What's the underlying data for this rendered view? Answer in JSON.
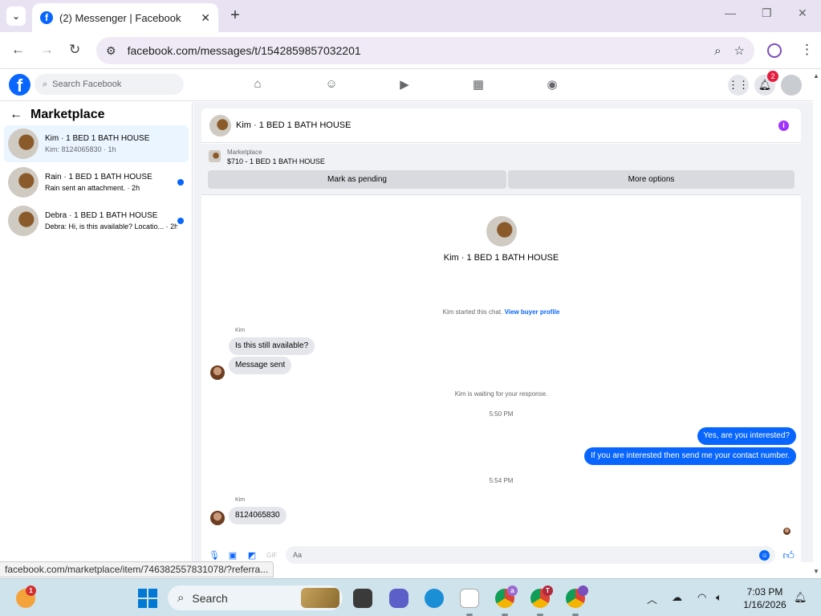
{
  "browser": {
    "tab_title": "(2) Messenger | Facebook",
    "favicon": "f",
    "url": "facebook.com/messages/t/1542859857032201",
    "status_url": "facebook.com/marketplace/item/746382557831078/?referra..."
  },
  "fb": {
    "logo": "f",
    "search_placeholder": "Search Facebook",
    "notification_count": "2"
  },
  "sidebar": {
    "title": "Marketplace",
    "conversations": [
      {
        "name": "Kim · 1 BED 1 BATH HOUSE",
        "snippet": "Kim: 8124065830 · 1h",
        "active": true,
        "unread": false
      },
      {
        "name": "Rain · 1 BED 1 BATH HOUSE",
        "snippet": "Rain sent an attachment. · 2h",
        "active": false,
        "unread": true
      },
      {
        "name": "Debra · 1 BED 1 BATH HOUSE",
        "snippet": "Debra: Hi, is this available? Locatio... · 2h",
        "active": false,
        "unread": true
      }
    ]
  },
  "chat": {
    "header_name": "Kim · 1 BED 1 BATH HOUSE",
    "listing_source": "Marketplace",
    "listing_price_title": "$710 - 1 BED 1 BATH HOUSE",
    "mark_pending": "Mark as pending",
    "more_options": "More options",
    "profile_name": "Kim · 1 BED 1 BATH HOUSE",
    "started_text": "Kim started this chat.",
    "view_profile": "View buyer profile",
    "sender_1": "Kim",
    "msg_1": "Is this still available?",
    "msg_2": "Message sent",
    "waiting": "Kim is waiting for your response.",
    "time_1": "5:50 PM",
    "out_1": "Yes, are you interested?",
    "out_2": "If you are interested then send me your contact number.",
    "time_2": "5:54 PM",
    "sender_2": "Kim",
    "msg_3": "8124065830",
    "composer_placeholder": "Aa"
  },
  "taskbar": {
    "search_label": "Search",
    "time": "7:03 PM",
    "date": "1/16/2026",
    "badge_1": "1",
    "badge_a": "a",
    "badge_t": "T"
  },
  "colors": {
    "accent": "#0866ff",
    "chrome_tabbar": "#e9e2f3",
    "taskbar": "#cfe3ec"
  }
}
